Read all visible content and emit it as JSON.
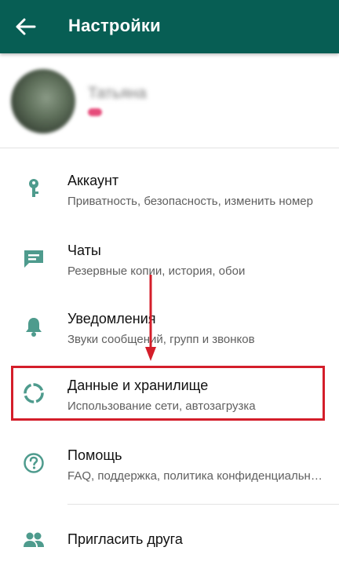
{
  "header": {
    "title": "Настройки",
    "back_icon": "arrow-left-icon",
    "bg_color": "#075e54"
  },
  "profile": {
    "name": "Татьяна",
    "status": "♥"
  },
  "menu": [
    {
      "id": "account",
      "label": "Аккаунт",
      "subtitle": "Приватность, безопасность, изменить номер",
      "icon": "key-icon"
    },
    {
      "id": "chats",
      "label": "Чаты",
      "subtitle": "Резервные копии, история, обои",
      "icon": "chat-icon"
    },
    {
      "id": "notifications",
      "label": "Уведомления",
      "subtitle": "Звуки сообщений, групп и звонков",
      "icon": "bell-icon"
    },
    {
      "id": "data-storage",
      "label": "Данные и хранилище",
      "subtitle": "Использование сети, автозагрузка",
      "icon": "data-circle-icon"
    },
    {
      "id": "help",
      "label": "Помощь",
      "subtitle": "FAQ, поддержка, политика конфиденциальности",
      "icon": "help-icon"
    },
    {
      "id": "invite",
      "label": "Пригласить друга",
      "subtitle": "",
      "icon": "people-icon"
    }
  ],
  "colors": {
    "icon": "#4e9b8d",
    "annotation": "#d41e2a"
  }
}
